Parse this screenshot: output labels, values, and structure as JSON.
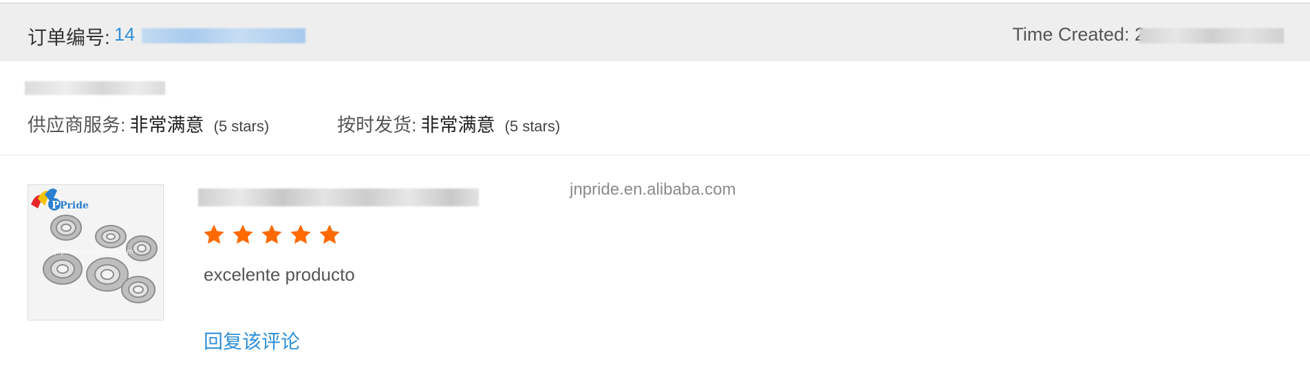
{
  "header": {
    "order_label": "订单编号:",
    "order_number_visible": "14",
    "time_label": "Time Created: 2"
  },
  "ratings": {
    "supplier_service": {
      "label": "供应商服务:",
      "value": "非常满意",
      "stars_text": "(5 stars)"
    },
    "on_time_delivery": {
      "label": "按时发货:",
      "value": "非常满意",
      "stars_text": "(5 stars)"
    }
  },
  "product": {
    "store": "jnpride.en.alibaba.com",
    "thumbnail_brand": "Pride",
    "thumbnail_watermark": "jnpride.en.alibaba.com",
    "star_rating": 5,
    "review_text": "excelente producto",
    "reply_label": "回复该评论"
  },
  "colors": {
    "header_bg": "#eeeeee",
    "link": "#2f8fd8",
    "star": "#ff6a00"
  },
  "icons": {
    "star": "star-icon"
  }
}
